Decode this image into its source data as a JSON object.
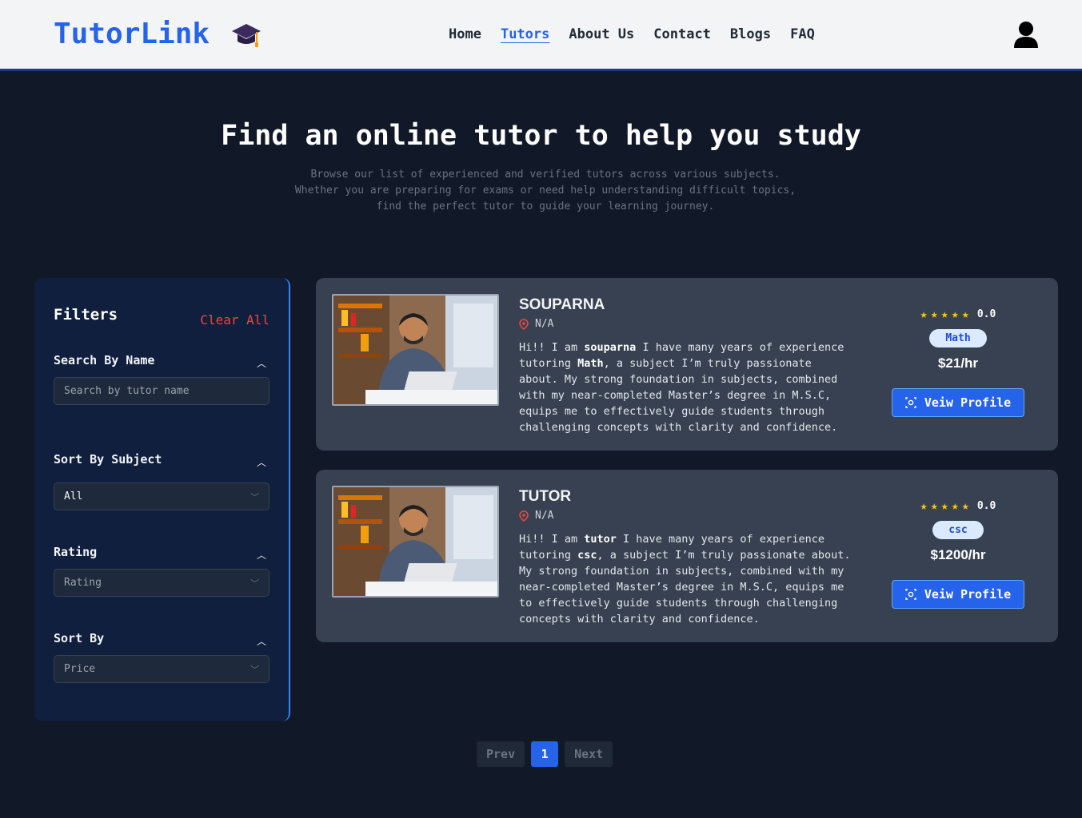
{
  "brand": {
    "name": "TutorLink"
  },
  "nav": {
    "items": [
      {
        "label": "Home",
        "active": false
      },
      {
        "label": "Tutors",
        "active": true
      },
      {
        "label": "About Us",
        "active": false
      },
      {
        "label": "Contact",
        "active": false
      },
      {
        "label": "Blogs",
        "active": false
      },
      {
        "label": "FAQ",
        "active": false
      }
    ]
  },
  "hero": {
    "title": "Find an online tutor to help you study",
    "subtitle_lines": [
      "Browse our list of experienced and verified tutors across various subjects.",
      "Whether you are preparing for exams or need help understanding difficult topics,",
      "find the perfect tutor to guide your learning journey."
    ]
  },
  "filters": {
    "title": "Filters",
    "clear_label": "Clear All",
    "search": {
      "label": "Search By Name",
      "placeholder": "Search by tutor name"
    },
    "subject": {
      "label": "Sort By Subject",
      "value": "All"
    },
    "rating": {
      "label": "Rating",
      "value": "Rating"
    },
    "sort": {
      "label": "Sort By",
      "value": "Price"
    }
  },
  "tutors": [
    {
      "name": "SOUPARNA",
      "location": "N/A",
      "bio_pre": "Hi!! I am ",
      "bio_name": "souparna",
      "bio_mid": " I have many years of experience tutoring ",
      "bio_subject": "Math",
      "bio_post": ", a subject I’m truly passionate about. My strong foundation in subjects, combined with my near-completed Master’s degree in M.S.C, equips me to effectively guide students through challenging concepts with clarity and confidence.",
      "rating": "0.0",
      "subject": "Math",
      "price": "$21/hr",
      "button": "Veiw Profile"
    },
    {
      "name": "TUTOR",
      "location": "N/A",
      "bio_pre": "Hi!! I am ",
      "bio_name": "tutor",
      "bio_mid": " I have many years of experience tutoring ",
      "bio_subject": "csc",
      "bio_post": ", a subject I’m truly passionate about. My strong foundation in subjects, combined with my near-completed Master’s degree in M.S.C, equips me to effectively guide students through challenging concepts with clarity and confidence.",
      "rating": "0.0",
      "subject": "csc",
      "price": "$1200/hr",
      "button": "Veiw Profile"
    }
  ],
  "pagination": {
    "prev": "Prev",
    "current": "1",
    "next": "Next"
  },
  "colors": {
    "accent": "#2563eb",
    "danger": "#ef4444",
    "star": "#fbbf24",
    "bg": "#111827"
  }
}
